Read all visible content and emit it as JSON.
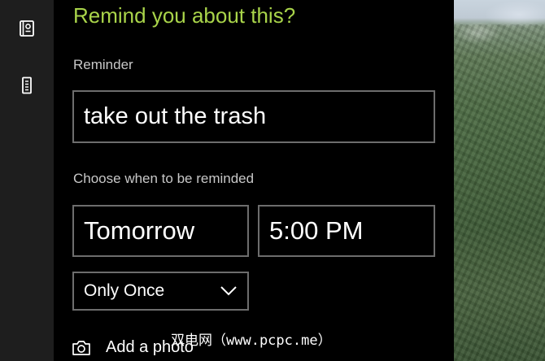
{
  "rail": {
    "items": [
      {
        "icon": "notebook-icon"
      },
      {
        "icon": "reminders-icon"
      }
    ]
  },
  "panel": {
    "title": "Remind you about this?",
    "reminder_label": "Reminder",
    "reminder_value": "take out the trash",
    "when_label": "Choose when to be reminded",
    "date_value": "Tomorrow",
    "time_value": "5:00 PM",
    "repeat_value": "Only Once",
    "add_photo_label": "Add a photo"
  },
  "watermark": "双电网（www.pcpc.me）",
  "colors": {
    "accent": "#a9d44a",
    "panel_bg": "#000000",
    "rail_bg": "#1e1e1e",
    "border": "#6d6d6d"
  }
}
